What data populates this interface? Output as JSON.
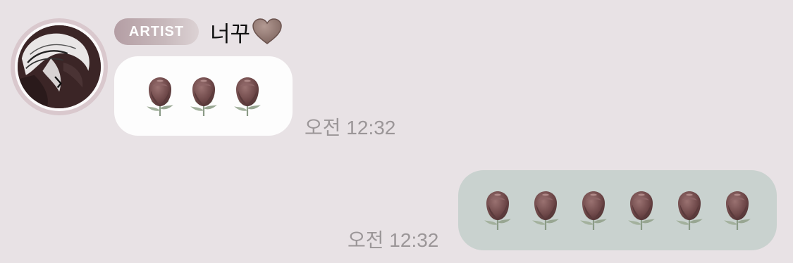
{
  "incoming": {
    "badge_label": "ARTIST",
    "sender_name": "너꾸",
    "message_emoji": "🌹🌹🌹",
    "time": "오전 12:32"
  },
  "outgoing": {
    "message_emoji": "🌹🌹🌹🌹🌹🌹",
    "time": "오전 12:32"
  },
  "colors": {
    "background": "#e8e2e5",
    "incoming_bubble": "#fdfdfd",
    "outgoing_bubble": "#c9d2cf",
    "badge": "#c3b2b7",
    "rose": "#6f4a4b",
    "heart": "#8a6f69"
  },
  "icons": {
    "avatar": "profile-picture",
    "heart": "brown-heart-emoji",
    "rose": "rose-emoji"
  }
}
